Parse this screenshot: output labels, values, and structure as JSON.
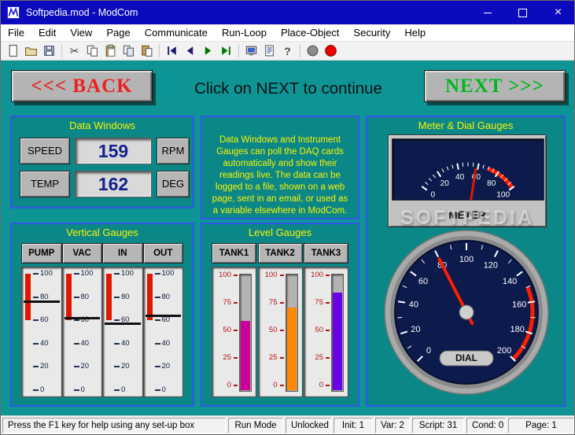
{
  "window": {
    "title": "Softpedia.mod - ModCom"
  },
  "menu": {
    "items": [
      "File",
      "Edit",
      "View",
      "Page",
      "Communicate",
      "Run-Loop",
      "Place-Object",
      "Security",
      "Help"
    ]
  },
  "toolbar": {
    "groups": [
      [
        "new",
        "open",
        "save"
      ],
      [
        "cut",
        "copy",
        "paste",
        "copy-page",
        "paste-page"
      ],
      [
        "first",
        "previous",
        "next",
        "last"
      ],
      [
        "display",
        "report",
        "help"
      ],
      [
        "stop",
        "record"
      ]
    ]
  },
  "nav": {
    "back_label": "<<<  BACK",
    "instruction": "Click on NEXT to continue",
    "next_label": "NEXT  >>>"
  },
  "data_windows": {
    "title": "Data Windows",
    "rows": [
      {
        "label": "SPEED",
        "value": "159",
        "unit": "RPM"
      },
      {
        "label": "TEMP",
        "value": "162",
        "unit": "DEG"
      }
    ]
  },
  "info_panel": {
    "text": "Data Windows and Instrument Gauges can poll the DAQ cards automatically and show their readings live. The data can be logged to a file, shown on a web page, sent in an email, or used as a variable elsewhere in ModCom."
  },
  "meter_dial": {
    "title": "Meter & Dial Gauges",
    "meter": {
      "label": "METER",
      "ticks": [
        0,
        20,
        40,
        60,
        80,
        100
      ],
      "value": 58,
      "red_zone": [
        70,
        100
      ]
    },
    "dial": {
      "label": "DIAL",
      "ticks": [
        0,
        20,
        40,
        60,
        80,
        100,
        120,
        140,
        160,
        180,
        200
      ],
      "value": 80,
      "red_zone": [
        150,
        200
      ]
    }
  },
  "vertical_gauges": {
    "title": "Vertical Gauges",
    "ticks": [
      100,
      80,
      60,
      40,
      20,
      0
    ],
    "red_zone": [
      60,
      100
    ],
    "gauges": [
      {
        "label": "PUMP",
        "value": 76
      },
      {
        "label": "VAC",
        "value": 62
      },
      {
        "label": "IN",
        "value": 57
      },
      {
        "label": "OUT",
        "value": 64
      }
    ]
  },
  "level_gauges": {
    "title": "Level Gauges",
    "ticks": [
      100,
      75,
      50,
      25,
      0
    ],
    "gauges": [
      {
        "label": "TANK1",
        "value": 60,
        "color": "#cc0099"
      },
      {
        "label": "TANK2",
        "value": 72,
        "color": "#ff8800"
      },
      {
        "label": "TANK3",
        "value": 85,
        "color": "#6a00e6"
      }
    ]
  },
  "status_bar": {
    "message": "Press the F1 key for help using any set-up box",
    "segments": [
      "Run Mode",
      "Unlocked",
      "Init: 1",
      "Var: 2",
      "Script: 31",
      "Cond: 0",
      "Page: 1"
    ]
  },
  "watermark": "SOFTPEDIA",
  "colors": {
    "background_teal": "#0e9494",
    "panel_border_blue": "#2f58e8",
    "title_yellow": "#f8f400",
    "back_red": "#ef1f1f",
    "next_green": "#00b71e",
    "gauge_face_navy": "#0c1a4c",
    "needle_red": "#ff1e00",
    "titlebar_blue": "#0b0bbd"
  }
}
